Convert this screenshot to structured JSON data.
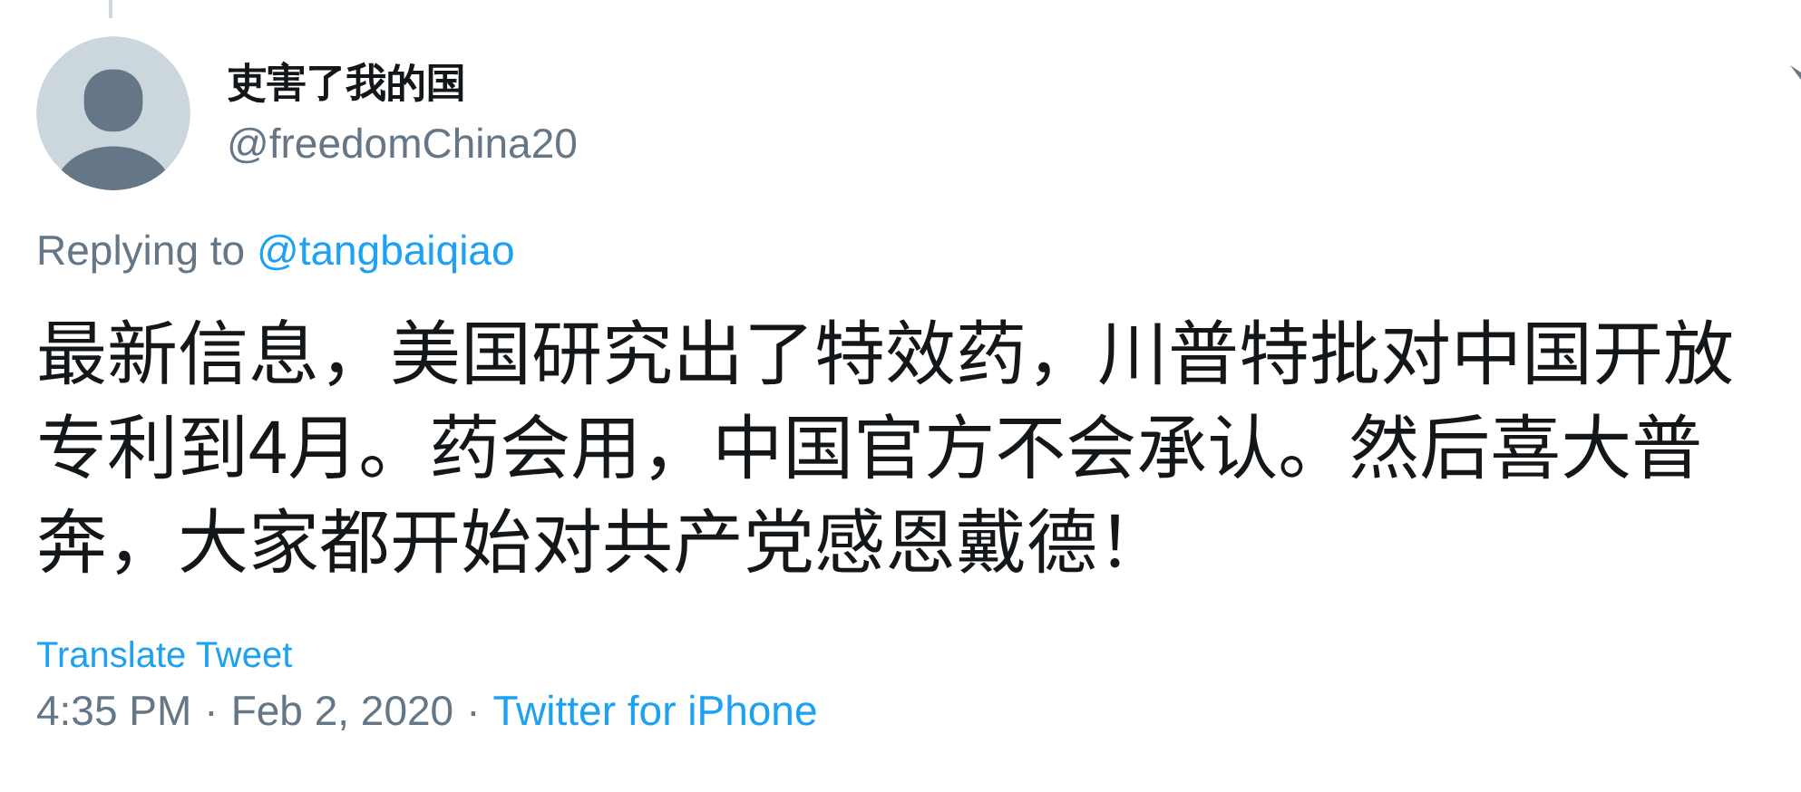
{
  "author": {
    "name": "吏害了我的国",
    "handle": "@freedomChina20"
  },
  "reply": {
    "prefix": "Replying to",
    "mention": "@tangbaiqiao"
  },
  "text": "最新信息，美国研究出了特效药，川普特批对中国开放专利到4月。药会用，中国官方不会承认。然后喜大普奔，大家都开始对共产党感恩戴德！",
  "translate": "Translate Tweet",
  "meta": {
    "time": "4:35 PM",
    "separator": "·",
    "date": "Feb 2, 2020",
    "separator_2": "·",
    "source": "Twitter for iPhone"
  }
}
